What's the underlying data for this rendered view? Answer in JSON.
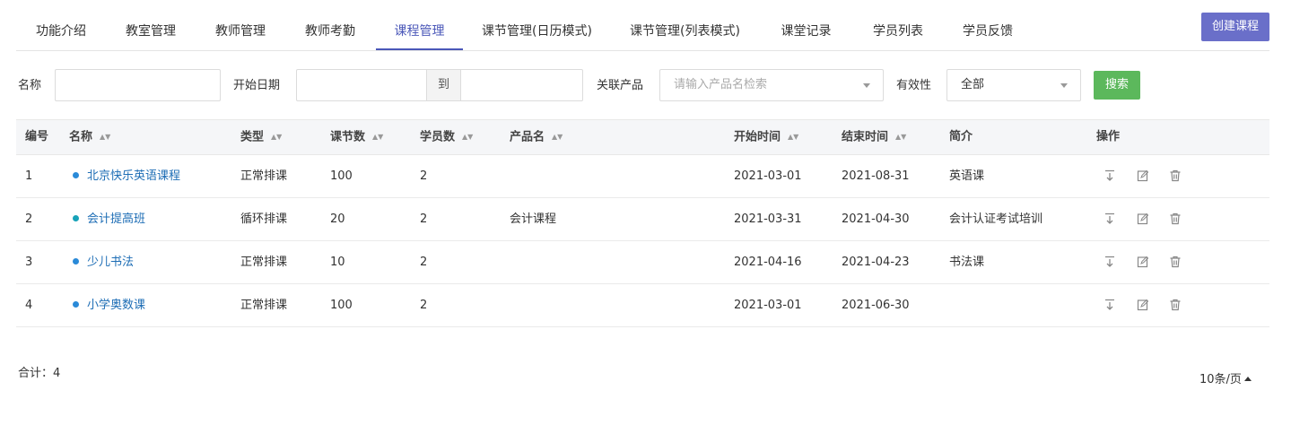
{
  "tabs": [
    {
      "label": "功能介绍"
    },
    {
      "label": "教室管理"
    },
    {
      "label": "教师管理"
    },
    {
      "label": "教师考勤"
    },
    {
      "label": "课程管理"
    },
    {
      "label": "课节管理(日历模式)"
    },
    {
      "label": "课节管理(列表模式)"
    },
    {
      "label": "课堂记录"
    },
    {
      "label": "学员列表"
    },
    {
      "label": "学员反馈"
    }
  ],
  "active_tab": "课程管理",
  "create_button": "创建课程",
  "filters": {
    "name_label": "名称",
    "name_value": "",
    "start_date_label": "开始日期",
    "date_to": "到",
    "product_label": "关联产品",
    "product_placeholder": "请输入产品名检索",
    "validity_label": "有效性",
    "validity_value": "全部",
    "search_button": "搜索"
  },
  "table": {
    "headers": {
      "id": "编号",
      "name": "名称",
      "type": "类型",
      "lessons": "课节数",
      "students": "学员数",
      "product": "产品名",
      "start": "开始时间",
      "end": "结束时间",
      "intro": "简介",
      "actions": "操作"
    },
    "rows": [
      {
        "id": "1",
        "name": "北京快乐英语课程",
        "dot_color": "#2a8ad8",
        "type": "正常排课",
        "lessons": "100",
        "students": "2",
        "product": "",
        "start": "2021-03-01",
        "end": "2021-08-31",
        "intro": "英语课"
      },
      {
        "id": "2",
        "name": "会计提高班",
        "dot_color": "#17a2b8",
        "type": "循环排课",
        "lessons": "20",
        "students": "2",
        "product": "会计课程",
        "start": "2021-03-31",
        "end": "2021-04-30",
        "intro": "会计认证考试培训"
      },
      {
        "id": "3",
        "name": "少儿书法",
        "dot_color": "#2a8ad8",
        "type": "正常排课",
        "lessons": "10",
        "students": "2",
        "product": "",
        "start": "2021-04-16",
        "end": "2021-04-23",
        "intro": "书法课"
      },
      {
        "id": "4",
        "name": "小学奥数课",
        "dot_color": "#2a8ad8",
        "type": "正常排课",
        "lessons": "100",
        "students": "2",
        "product": "",
        "start": "2021-03-01",
        "end": "2021-06-30",
        "intro": ""
      }
    ]
  },
  "footer": {
    "total": "合计：4",
    "page_size": "10条/页"
  },
  "icons": {
    "sort": "sort-icon",
    "export": "download-icon",
    "edit": "edit-icon",
    "delete": "trash-icon"
  },
  "colors": {
    "accent": "#4a57b8",
    "create_button": "#6a6fc9",
    "search_button": "#5cb85c",
    "link": "#1d6db5"
  }
}
